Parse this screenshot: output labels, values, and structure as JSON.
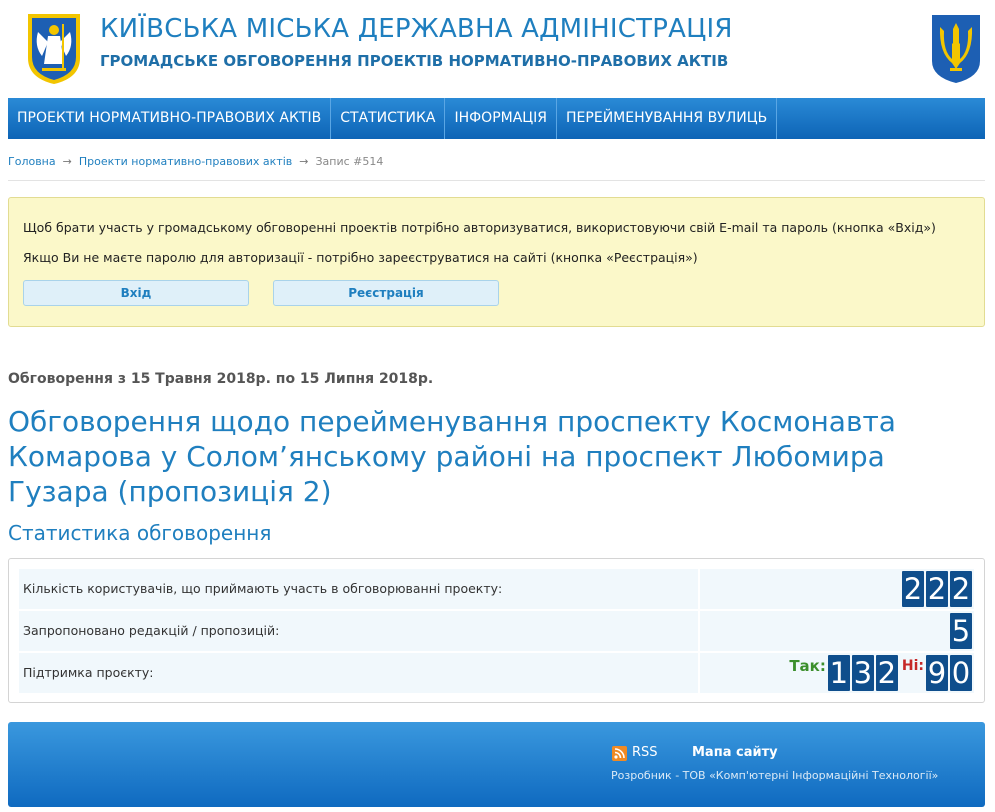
{
  "header": {
    "title": "КИЇВСЬКА МІСЬКА ДЕРЖАВНА АДМІНІСТРАЦІЯ",
    "subtitle": "ГРОМАДСЬКЕ ОБГОВОРЕННЯ ПРОЕКТІВ НОРМАТИВНО-ПРАВОВИХ АКТІВ",
    "left_emblem_icon": "kyiv-coat-of-arms-icon",
    "right_emblem_icon": "ukraine-trident-icon"
  },
  "nav": {
    "items": [
      {
        "label": "ПРОЕКТИ НОРМАТИВНО-ПРАВОВИХ АКТІВ"
      },
      {
        "label": "СТАТИСТИКА"
      },
      {
        "label": "ІНФОРМАЦІЯ"
      },
      {
        "label": "ПЕРЕЙМЕНУВАННЯ ВУЛИЦЬ"
      }
    ]
  },
  "breadcrumb": {
    "home": "Головна",
    "section": "Проекти нормативно-правових актів",
    "current": "Запис #514",
    "separator": "→"
  },
  "notice": {
    "line1": "Щоб брати участь у громадському обговоренні проектів потрібно авторизуватися, використовуючи свій E-mail та пароль (кнопка «Вхід»)",
    "line2": "Якщо Ви не маєте паролю для авторизації - потрібно зареєструватися на сайті (кнопка «Реєстрація»)",
    "login_label": "Вхід",
    "register_label": "Реєстрація"
  },
  "discussion": {
    "period": "Обговорення з 15 Травня 2018р. по 15 Липня 2018р.",
    "title": "Обговорення щодо перейменування проспекту Космонавта Комарова у Солом’янському районі на проспект Любомира Гузара (пропозиція 2)"
  },
  "stats": {
    "heading": "Статистика обговорення",
    "rows": [
      {
        "label": "Кількість користувачів, що приймають участь в обговорюванні проекту:",
        "value": "222"
      },
      {
        "label": "Запропоновано редакцій / пропозицій:",
        "value": "5"
      },
      {
        "label": "Підтримка проєкту:",
        "yes_label": "Так:",
        "yes_value": "132",
        "no_label": "Ні:",
        "no_value": "90"
      }
    ]
  },
  "footer": {
    "rss_label": "RSS",
    "rss_icon": "rss-icon",
    "sitemap_label": "Мапа сайту",
    "developer": "Розробник - ТОВ «Комп'ютерні Інформаційні Технології»"
  },
  "colors": {
    "accent": "#1f7fbf",
    "nav_top": "#2a8ad6",
    "nav_bottom": "#0d64b6",
    "digit_bg": "#0f4e8c",
    "notice_bg": "#fbf8c9",
    "yes": "#3c8f2c",
    "no": "#c62828"
  }
}
